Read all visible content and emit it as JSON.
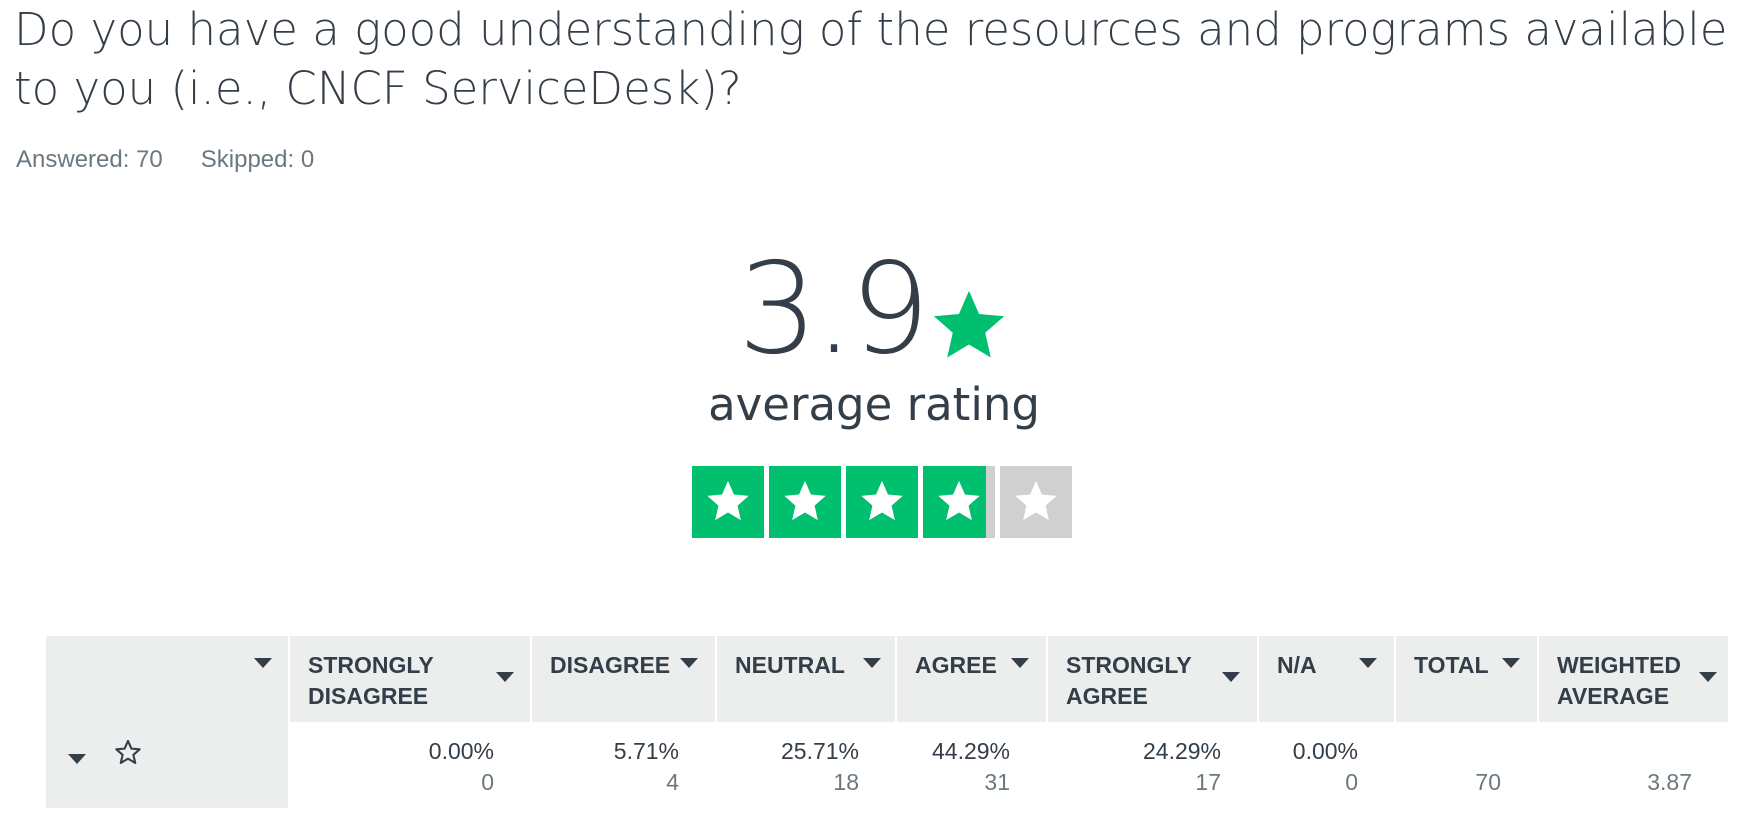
{
  "question": {
    "title": "Do you have a good understanding of the resources and programs available to you (i.e., CNCF ServiceDesk)?",
    "answered": "Answered: 70",
    "skipped": "Skipped: 0"
  },
  "rating": {
    "value": "3.9",
    "label": "average rating",
    "score": 3.87,
    "max": 5,
    "accent_color": "#00bf6f",
    "empty_color": "#d0d0d0"
  },
  "table": {
    "columns": [
      "",
      "STRONGLY DISAGREE",
      "DISAGREE",
      "NEUTRAL",
      "AGREE",
      "STRONGLY AGREE",
      "N/A",
      "TOTAL",
      "WEIGHTED AVERAGE"
    ],
    "row": {
      "icon": "star-outline-icon",
      "cells": [
        {
          "pct": "0.00%",
          "count": "0"
        },
        {
          "pct": "5.71%",
          "count": "4"
        },
        {
          "pct": "25.71%",
          "count": "18"
        },
        {
          "pct": "44.29%",
          "count": "31"
        },
        {
          "pct": "24.29%",
          "count": "17"
        },
        {
          "pct": "0.00%",
          "count": "0"
        }
      ],
      "total": "70",
      "weighted_average": "3.87"
    }
  }
}
